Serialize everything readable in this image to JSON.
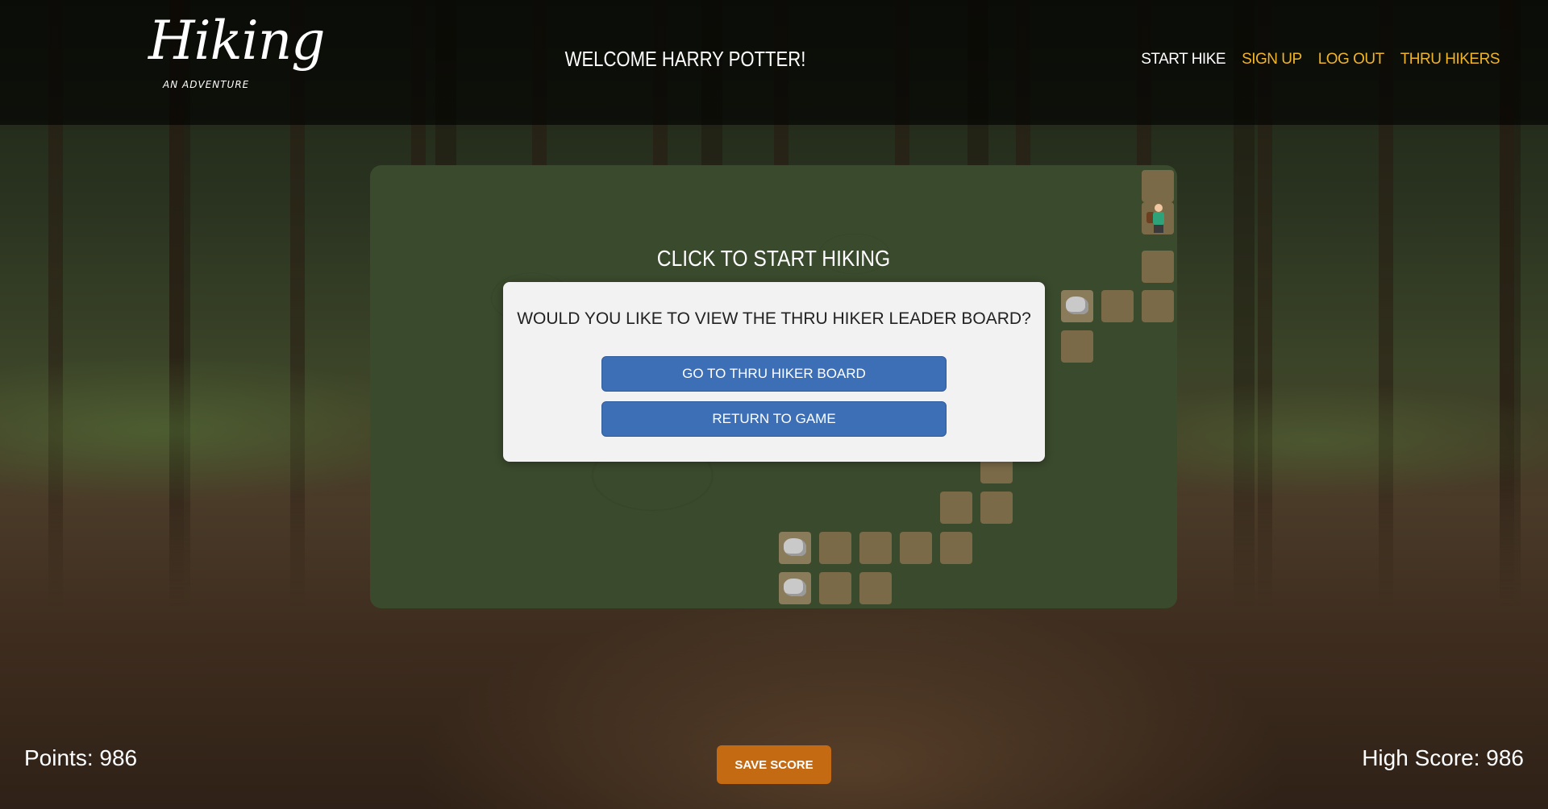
{
  "header": {
    "logo": {
      "main": "Hiking",
      "sub": "AN ADVENTURE"
    },
    "welcome": "WELCOME HARRY POTTER!",
    "nav": [
      {
        "label": "START HIKE",
        "active": true
      },
      {
        "label": "SIGN UP",
        "active": false
      },
      {
        "label": "LOG OUT",
        "active": false
      },
      {
        "label": "THRU HIKERS",
        "active": false
      }
    ],
    "nav_colors": {
      "active": "#ffffff",
      "inactive": "#f0b429"
    }
  },
  "game": {
    "prompt": "CLICK TO START HIKING",
    "board_color": "#3a4a2c",
    "tile_color": "#7a6a47"
  },
  "modal": {
    "question": "WOULD YOU LIKE TO VIEW THE THRU HIKER LEADER BOARD?",
    "primary_button": "GO TO THRU HIKER BOARD",
    "secondary_button": "RETURN TO GAME",
    "button_color": "#3d6fb6"
  },
  "footer": {
    "points_label": "Points: 986",
    "points": 986,
    "high_score_label": "High Score: 986",
    "high_score": 986,
    "save_button": "SAVE SCORE",
    "save_color": "#c46a12"
  }
}
